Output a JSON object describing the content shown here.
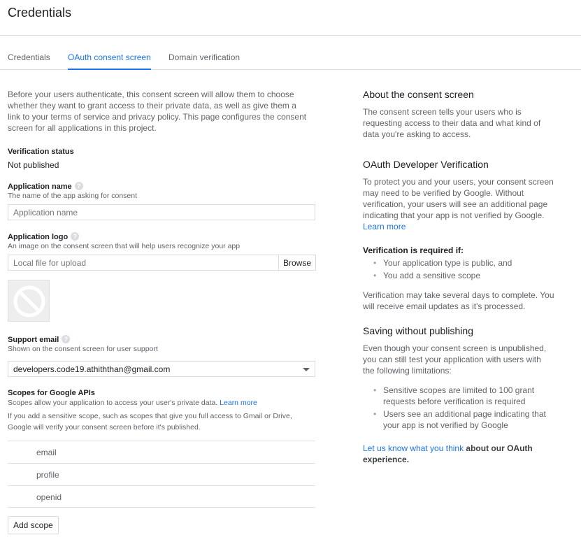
{
  "header": {
    "title": "Credentials"
  },
  "tabs": [
    {
      "label": "Credentials"
    },
    {
      "label": "OAuth consent screen"
    },
    {
      "label": "Domain verification"
    }
  ],
  "intro": {
    "line1": "Before your users authenticate, this consent screen will allow them to choose",
    "line2": "whether they want to grant access to their private data, as well as give them a",
    "line3": "link to your terms of service and privacy policy. This page configures the consent",
    "line4": "screen for all applications in this project."
  },
  "verification": {
    "label": "Verification status",
    "value": "Not published"
  },
  "app_name": {
    "label": "Application name",
    "hint": "The name of the app asking for consent",
    "placeholder": "Application name"
  },
  "app_logo": {
    "label": "Application logo",
    "hint": "An image on the consent screen that will help users recognize your app",
    "placeholder": "Local file for upload",
    "browse": "Browse"
  },
  "support_email": {
    "label": "Support email",
    "hint": "Shown on the consent screen for user support",
    "value": "developers.code19.athiththan@gmail.com"
  },
  "scopes": {
    "label": "Scopes for Google APIs",
    "hint": "Scopes allow your application to access your user's private data.",
    "hint_link": "Learn more",
    "note1": "If you add a sensitive scope, such as scopes that give you full access to Gmail or Drive,",
    "note2": "Google will verify your consent screen before it's published.",
    "items": [
      "email",
      "profile",
      "openid"
    ],
    "add_button": "Add scope"
  },
  "about": {
    "heading": "About the consent screen",
    "l1": "The consent screen tells your users who is",
    "l2": "requesting access to their data and what kind of",
    "l3": "data you're asking to access."
  },
  "oauth_verification": {
    "heading": "OAuth Developer Verification",
    "l1": "To protect you and your users, your consent screen",
    "l2": "may need to be verified by Google. Without",
    "l3": "verification, your users will see an additional page",
    "l4": "indicating that your app is not verified by Google.",
    "link": "Learn more"
  },
  "required": {
    "label": "Verification is required if:",
    "items": [
      "Your application type is public, and",
      "You add a sensitive scope"
    ],
    "note1": "Verification may take several days to complete. You",
    "note2": "will receive email updates as it's processed."
  },
  "saving": {
    "heading": "Saving without publishing",
    "l1": "Even though your consent screen is unpublished,",
    "l2": "you can still test your application with users with",
    "l3": "the following limitations:",
    "b1l1": "Sensitive scopes are limited to 100 grant",
    "b1l2": "requests before verification is required",
    "b2l1": "Users see an additional page indicating that",
    "b2l2": "your app is not verified by Google"
  },
  "feedback": {
    "link": "Let us know what you think",
    "rest": " about our OAuth",
    "line2": "experience."
  }
}
